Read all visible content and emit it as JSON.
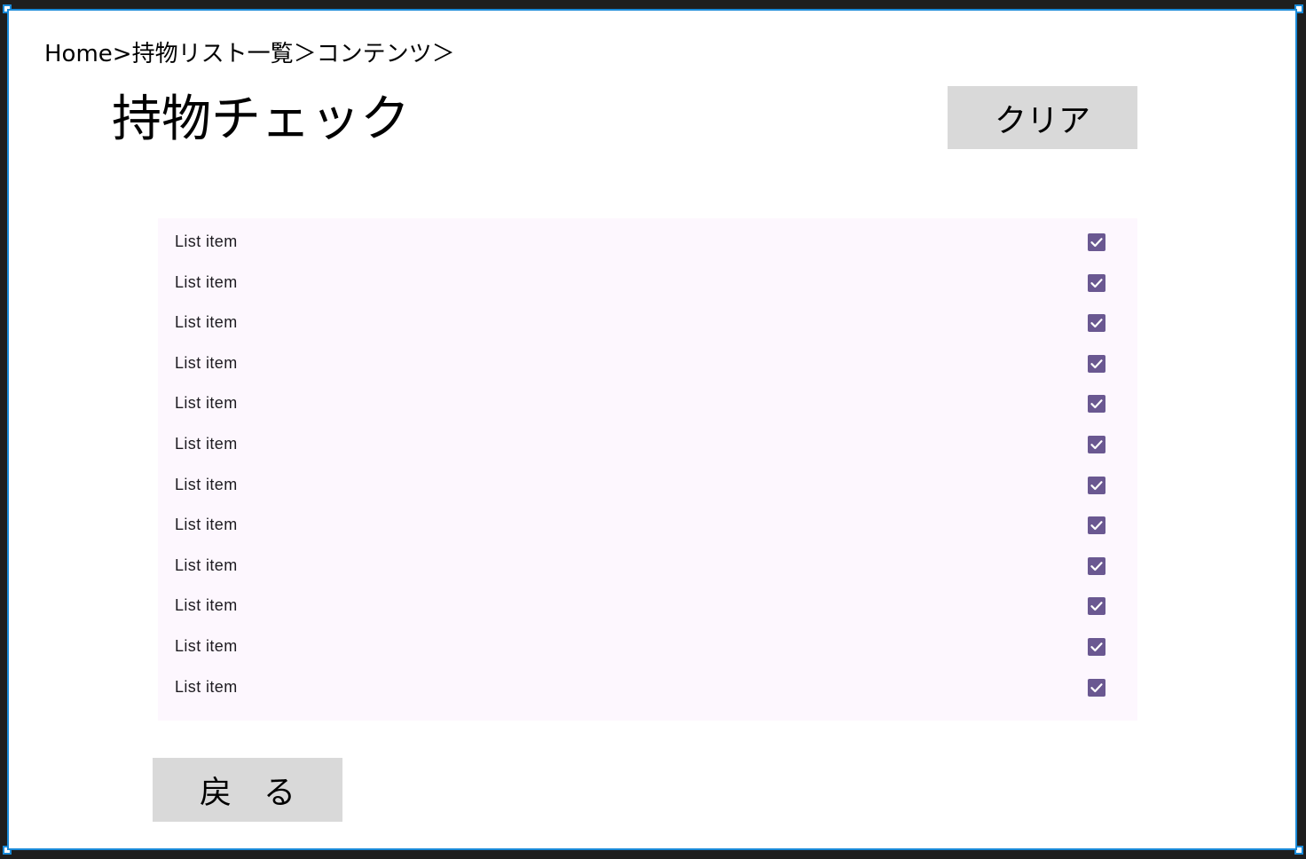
{
  "breadcrumb": "Home>持物リスト一覧＞コンテンツ＞",
  "page_title": "持物チェック",
  "buttons": {
    "clear_label": "クリア",
    "back_label": "戻　る"
  },
  "list": {
    "items": [
      {
        "label": "List item",
        "checked": true
      },
      {
        "label": "List item",
        "checked": true
      },
      {
        "label": "List item",
        "checked": true
      },
      {
        "label": "List item",
        "checked": true
      },
      {
        "label": "List item",
        "checked": true
      },
      {
        "label": "List item",
        "checked": true
      },
      {
        "label": "List item",
        "checked": true
      },
      {
        "label": "List item",
        "checked": true
      },
      {
        "label": "List item",
        "checked": true
      },
      {
        "label": "List item",
        "checked": true
      },
      {
        "label": "List item",
        "checked": true
      },
      {
        "label": "List item",
        "checked": true
      }
    ]
  },
  "colors": {
    "checkbox": "#6a5891",
    "list_background": "#fdf7fe",
    "button_background": "#d9d9d9",
    "selection_border": "#1a8ad8"
  },
  "icons": {
    "checkbox_mark": "check-icon"
  }
}
